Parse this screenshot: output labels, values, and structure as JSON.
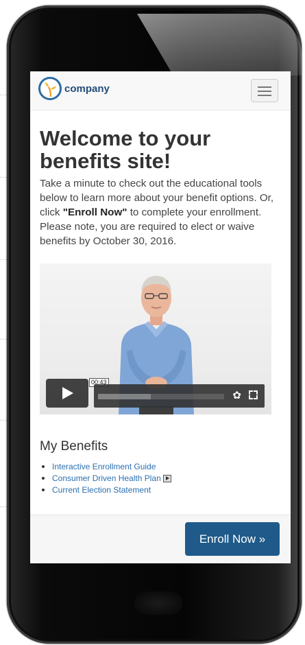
{
  "navbar": {
    "logo_text": "company",
    "menu_icon": "hamburger-menu-icon"
  },
  "main": {
    "heading": "Welcome to your benefits site!",
    "intro_before": "Take a minute to check out the educational tools below to learn more about your benefit options. Or, click ",
    "intro_bold": "\"Enroll Now\"",
    "intro_after": " to complete your enrollment. Please note, you are required to elect or waive benefits by October 30, 2016."
  },
  "video": {
    "time": "00:43",
    "progress": 0.42,
    "play_icon": "play-icon",
    "settings_icon": "gear-icon",
    "fullscreen_icon": "fullscreen-icon"
  },
  "benefits": {
    "title": "My Benefits",
    "links": [
      "Interactive Enrollment Guide",
      "Consumer Driven Health Plan",
      "Current Election Statement"
    ]
  },
  "footer": {
    "enroll_label": "Enroll Now »"
  },
  "colors": {
    "primary": "#1f5a8a",
    "link": "#2a6fb0",
    "text": "#333333"
  }
}
